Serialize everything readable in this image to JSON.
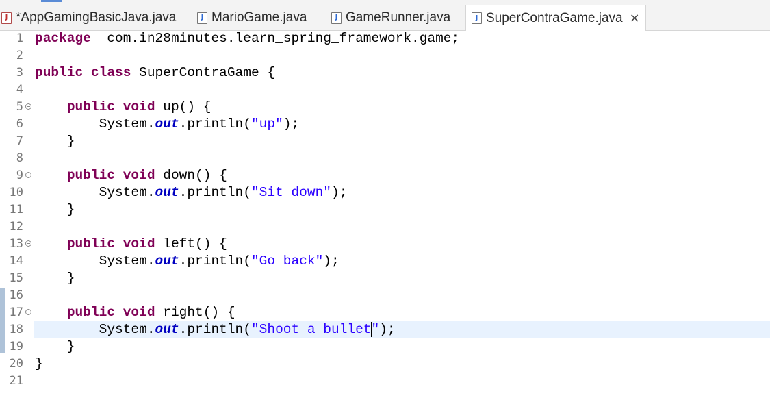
{
  "tabs": [
    {
      "label": "*AppGamingBasicJava.java",
      "icon": "java-file-modified-icon",
      "active": false
    },
    {
      "label": "MarioGame.java",
      "icon": "java-file-icon",
      "active": false
    },
    {
      "label": "GameRunner.java",
      "icon": "java-file-icon",
      "active": false
    },
    {
      "label": "SuperContraGame.java",
      "icon": "java-file-icon",
      "active": true,
      "close": "×"
    }
  ],
  "editor": {
    "current_line": 18,
    "lines": [
      {
        "n": "1",
        "tokens": [
          [
            "kw",
            "package"
          ],
          [
            "",
            "  com.in28minutes.learn_spring_framework.game;"
          ]
        ]
      },
      {
        "n": "2",
        "tokens": []
      },
      {
        "n": "3",
        "tokens": [
          [
            "kw",
            "public"
          ],
          [
            "",
            " "
          ],
          [
            "kw",
            "class"
          ],
          [
            "",
            " SuperContraGame {"
          ]
        ]
      },
      {
        "n": "4",
        "tokens": []
      },
      {
        "n": "5",
        "fold": true,
        "tokens": [
          [
            "",
            "    "
          ],
          [
            "kw",
            "public"
          ],
          [
            "",
            " "
          ],
          [
            "kw",
            "void"
          ],
          [
            "",
            " up() {"
          ]
        ]
      },
      {
        "n": "6",
        "tokens": [
          [
            "",
            "        System."
          ],
          [
            "fld",
            "out"
          ],
          [
            "",
            ".println("
          ],
          [
            "str",
            "\"up\""
          ],
          [
            "",
            ");"
          ]
        ]
      },
      {
        "n": "7",
        "tokens": [
          [
            "",
            "    }"
          ]
        ]
      },
      {
        "n": "8",
        "tokens": []
      },
      {
        "n": "9",
        "fold": true,
        "tokens": [
          [
            "",
            "    "
          ],
          [
            "kw",
            "public"
          ],
          [
            "",
            " "
          ],
          [
            "kw",
            "void"
          ],
          [
            "",
            " down() {"
          ]
        ]
      },
      {
        "n": "10",
        "tokens": [
          [
            "",
            "        System."
          ],
          [
            "fld",
            "out"
          ],
          [
            "",
            ".println("
          ],
          [
            "str",
            "\"Sit down\""
          ],
          [
            "",
            ");"
          ]
        ]
      },
      {
        "n": "11",
        "tokens": [
          [
            "",
            "    }"
          ]
        ]
      },
      {
        "n": "12",
        "tokens": []
      },
      {
        "n": "13",
        "fold": true,
        "tokens": [
          [
            "",
            "    "
          ],
          [
            "kw",
            "public"
          ],
          [
            "",
            " "
          ],
          [
            "kw",
            "void"
          ],
          [
            "",
            " left() {"
          ]
        ]
      },
      {
        "n": "14",
        "tokens": [
          [
            "",
            "        System."
          ],
          [
            "fld",
            "out"
          ],
          [
            "",
            ".println("
          ],
          [
            "str",
            "\"Go back\""
          ],
          [
            "",
            ");"
          ]
        ]
      },
      {
        "n": "15",
        "tokens": [
          [
            "",
            "    }"
          ]
        ]
      },
      {
        "n": "16",
        "tokens": []
      },
      {
        "n": "17",
        "fold": true,
        "tokens": [
          [
            "",
            "    "
          ],
          [
            "kw",
            "public"
          ],
          [
            "",
            " "
          ],
          [
            "kw",
            "void"
          ],
          [
            "",
            " right() {"
          ]
        ]
      },
      {
        "n": "18",
        "tokens": [
          [
            "",
            "        System."
          ],
          [
            "fld",
            "out"
          ],
          [
            "",
            ".println("
          ],
          [
            "str",
            "\"Shoot a bullet"
          ],
          [
            "caret",
            ""
          ],
          [
            "str",
            "\""
          ],
          [
            "",
            ");"
          ]
        ]
      },
      {
        "n": "19",
        "tokens": [
          [
            "",
            "    }"
          ]
        ]
      },
      {
        "n": "20",
        "tokens": [
          [
            "",
            "}"
          ]
        ]
      },
      {
        "n": "21",
        "tokens": []
      }
    ]
  }
}
